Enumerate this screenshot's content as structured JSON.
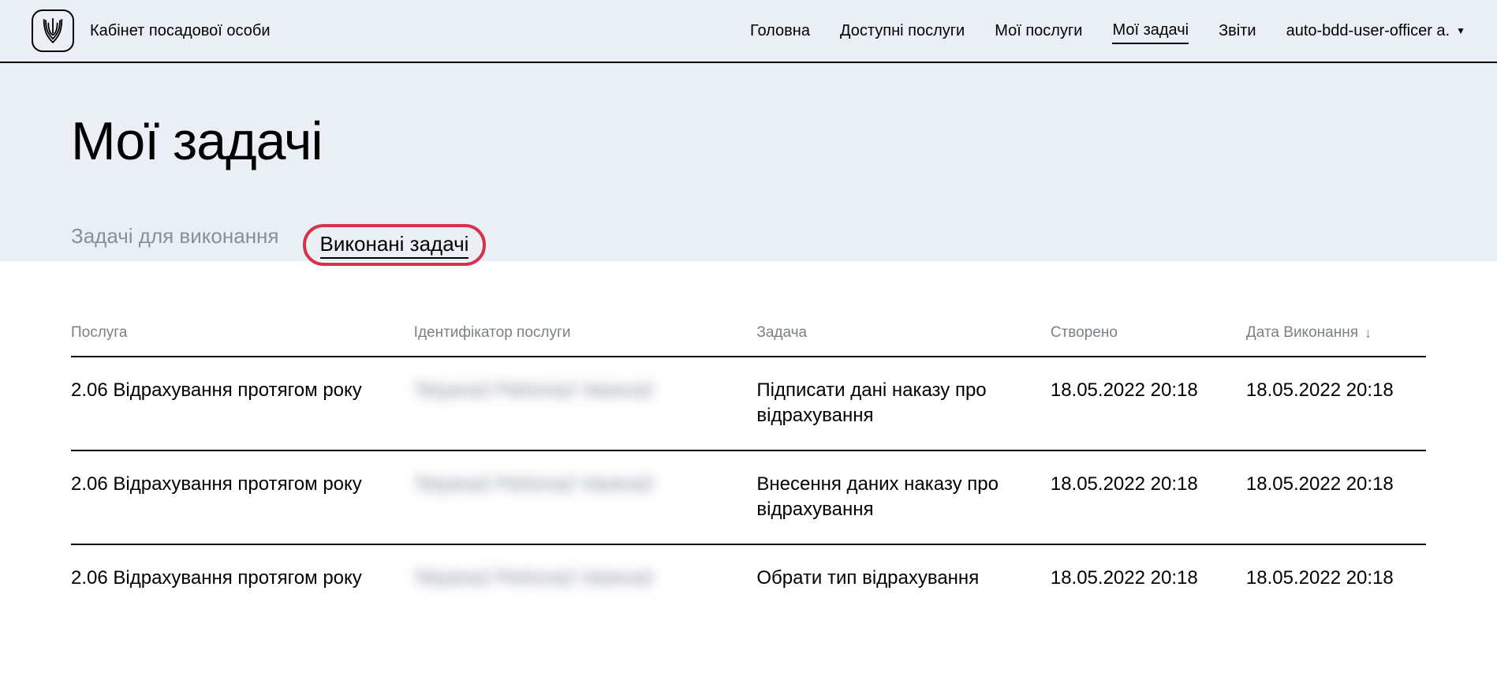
{
  "header": {
    "app_title": "Кабінет посадової особи",
    "nav": [
      {
        "label": "Головна",
        "active": false
      },
      {
        "label": "Доступні послуги",
        "active": false
      },
      {
        "label": "Мої послуги",
        "active": false
      },
      {
        "label": "Мої задачі",
        "active": true
      },
      {
        "label": "Звіти",
        "active": false
      }
    ],
    "user_label": "auto-bdd-user-officer a."
  },
  "page": {
    "title": "Мої задачі",
    "tabs": [
      {
        "label": "Задачі для виконання",
        "active": false
      },
      {
        "label": "Виконані задачі",
        "active": true
      }
    ]
  },
  "table": {
    "columns": {
      "service": "Послуга",
      "identifier": "Ідентифікатор послуги",
      "task": "Задача",
      "created": "Створено",
      "completed": "Дата Виконання"
    },
    "rows": [
      {
        "service": "2.06 Відрахування протягом року",
        "identifier": "Tetyana2 Petrivna2 Vaseva2",
        "task": "Підписати дані наказу про відрахування",
        "created": "18.05.2022 20:18",
        "completed": "18.05.2022 20:18"
      },
      {
        "service": "2.06 Відрахування протягом року",
        "identifier": "Tetyana2 Petrivna2 Vaseva2",
        "task": "Внесення даних наказу про відрахування",
        "created": "18.05.2022 20:18",
        "completed": "18.05.2022 20:18"
      },
      {
        "service": "2.06 Відрахування протягом року",
        "identifier": "Tetyana2 Petrivna2 Vaseva2",
        "task": "Обрати тип відрахування",
        "created": "18.05.2022 20:18",
        "completed": "18.05.2022 20:18"
      }
    ]
  }
}
